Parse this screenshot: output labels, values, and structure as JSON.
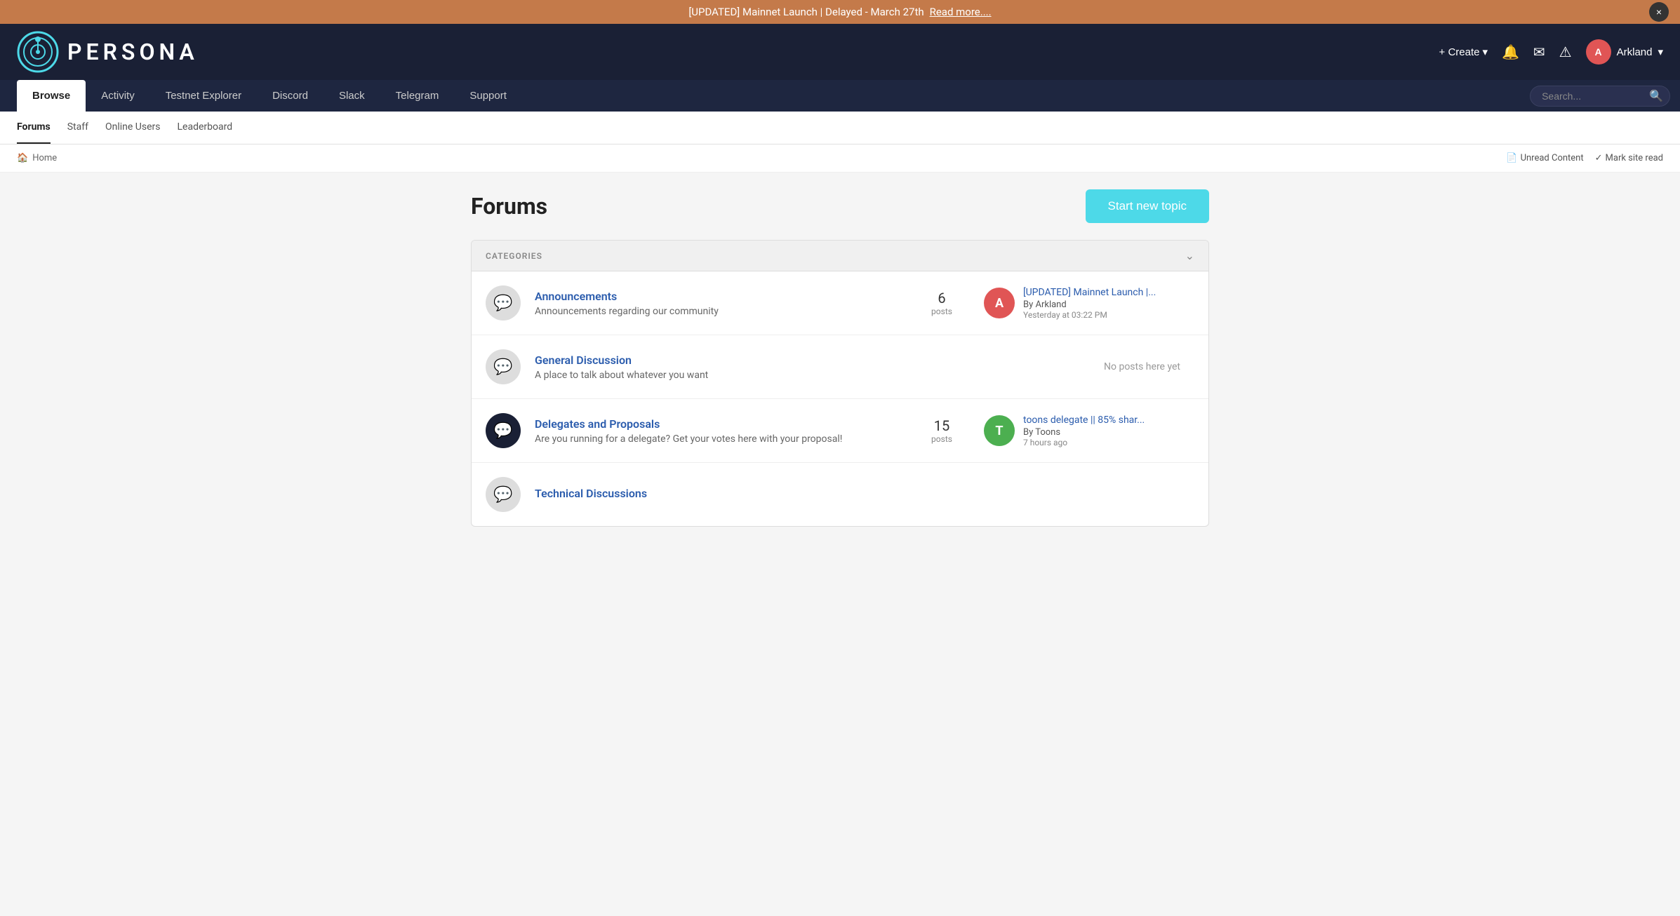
{
  "banner": {
    "text": "[UPDATED] Mainnet Launch | Delayed - March 27th",
    "link_text": "Read more....",
    "close_label": "×"
  },
  "header": {
    "logo_text": "PERSONA",
    "create_label": "+ Create",
    "user_name": "Arkland",
    "user_initial": "A"
  },
  "navbar": {
    "tabs": [
      {
        "label": "Browse",
        "active": true
      },
      {
        "label": "Activity"
      },
      {
        "label": "Testnet Explorer"
      },
      {
        "label": "Discord"
      },
      {
        "label": "Slack"
      },
      {
        "label": "Telegram"
      },
      {
        "label": "Support"
      }
    ],
    "search_placeholder": "Search..."
  },
  "subnav": {
    "items": [
      {
        "label": "Forums",
        "active": true
      },
      {
        "label": "Staff"
      },
      {
        "label": "Online Users"
      },
      {
        "label": "Leaderboard"
      }
    ]
  },
  "breadcrumb": {
    "home_label": "Home",
    "unread_label": "Unread Content",
    "mark_read_label": "Mark site read"
  },
  "page": {
    "title": "Forums",
    "start_topic_label": "Start new topic"
  },
  "categories": {
    "header_label": "CATEGORIES",
    "items": [
      {
        "name": "Announcements",
        "desc": "Announcements regarding our community",
        "posts_count": "6",
        "posts_label": "posts",
        "icon_type": "light",
        "latest_title": "[UPDATED] Mainnet Launch |...",
        "latest_author": "By Arkland",
        "latest_time": "Yesterday at 03:22 PM",
        "latest_avatar_color": "#e05555",
        "latest_avatar_initial": "A",
        "has_posts": true
      },
      {
        "name": "General Discussion",
        "desc": "A place to talk about whatever you want",
        "posts_count": "",
        "posts_label": "",
        "icon_type": "light",
        "latest_title": "",
        "latest_author": "",
        "latest_time": "",
        "latest_avatar_color": "",
        "latest_avatar_initial": "",
        "no_posts_text": "No posts here yet",
        "has_posts": false
      },
      {
        "name": "Delegates and Proposals",
        "desc": "Are you running for a delegate? Get your votes here with your proposal!",
        "posts_count": "15",
        "posts_label": "posts",
        "icon_type": "dark",
        "latest_title": "toons delegate || 85% shar...",
        "latest_author": "By Toons",
        "latest_time": "7 hours ago",
        "latest_avatar_color": "#4caf50",
        "latest_avatar_initial": "T",
        "has_posts": true
      },
      {
        "name": "Technical Discussions",
        "desc": "",
        "posts_count": "",
        "posts_label": "",
        "icon_type": "light",
        "latest_title": "",
        "latest_author": "",
        "latest_time": "",
        "latest_avatar_color": "",
        "latest_avatar_initial": "",
        "has_posts": false,
        "partial": true
      }
    ]
  }
}
